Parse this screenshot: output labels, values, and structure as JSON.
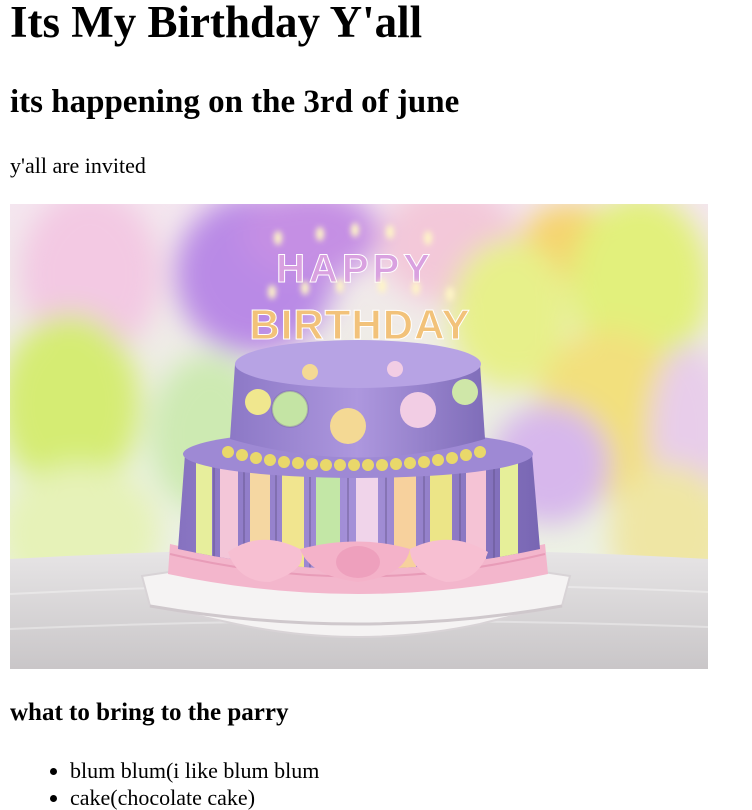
{
  "header": {
    "title": "Its My Birthday Y'all",
    "subtitle": "its happening on the 3rd of june"
  },
  "intro": {
    "text": "y'all are invited"
  },
  "photo": {
    "topper_line1": "HAPPY",
    "topper_line2": "BIRTHDAY",
    "colors": {
      "cake_purple": "#a98fd8",
      "ribbon_pink": "#f3b6cc",
      "balloon_green": "#d8ef6a",
      "balloon_yellow": "#f6e27a",
      "balloon_purple": "#c98fe8"
    }
  },
  "bring": {
    "heading": "what to bring to the parry",
    "items": [
      {
        "text": "blum blum(i like blum blum"
      },
      {
        "text": "cake(chocolate cake)"
      }
    ]
  }
}
